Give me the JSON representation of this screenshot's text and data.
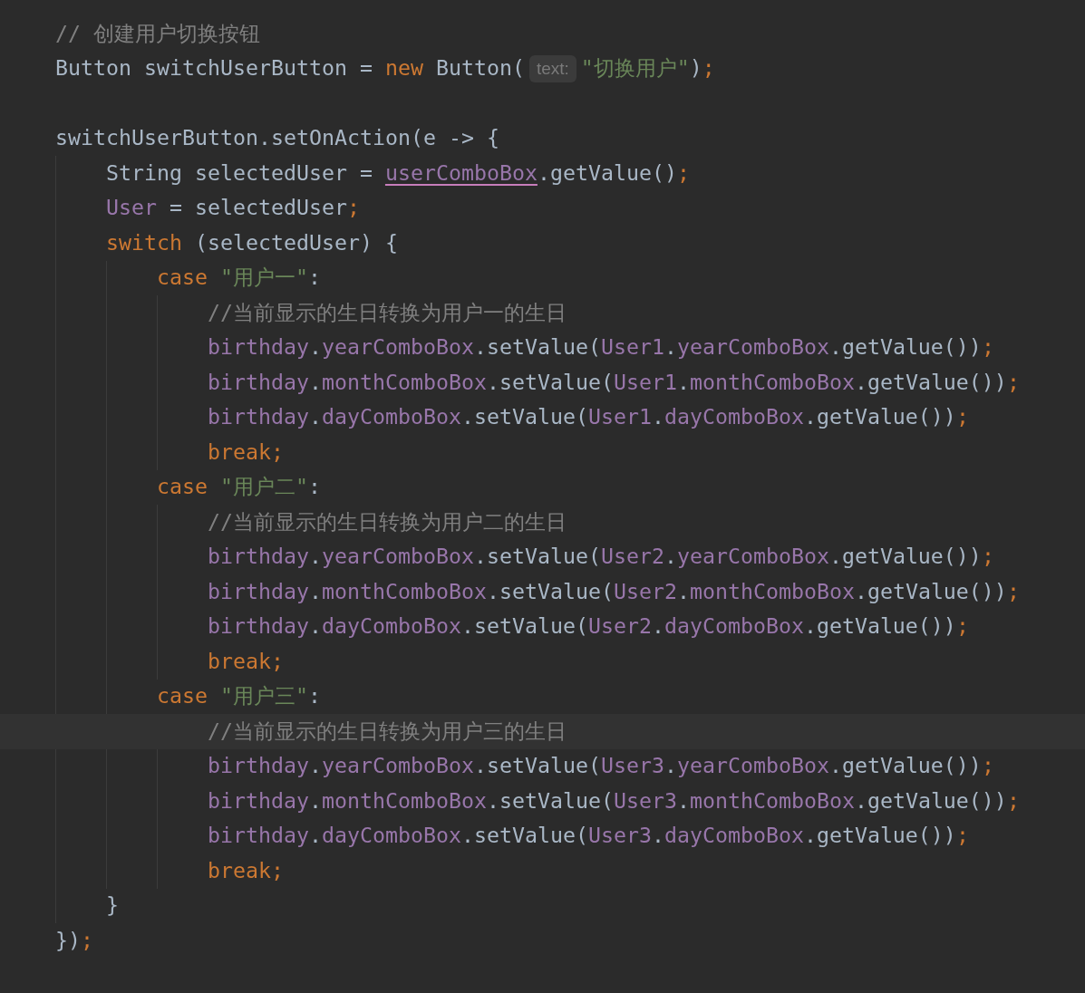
{
  "lines": [
    {
      "kind": "code",
      "tokens": [
        {
          "kind": "comment",
          "text": "// 创建用户切换按钮"
        }
      ]
    },
    {
      "kind": "code",
      "tokens": [
        {
          "kind": "plain",
          "text": "Button switchUserButton = "
        },
        {
          "kind": "keyword",
          "text": "new"
        },
        {
          "kind": "plain",
          "text": " Button("
        },
        {
          "kind": "hint",
          "text": "text:"
        },
        {
          "kind": "string",
          "text": "\"切换用户\""
        },
        {
          "kind": "plain",
          "text": ")"
        },
        {
          "kind": "keyword",
          "text": ";"
        }
      ]
    },
    {
      "kind": "blank"
    },
    {
      "kind": "code",
      "tokens": [
        {
          "kind": "plain",
          "text": "switchUserButton.setOnAction(e -> {"
        }
      ],
      "children": [
        {
          "kind": "code",
          "tokens": [
            {
              "kind": "plain",
              "text": "String selectedUser = "
            },
            {
              "kind": "underlined",
              "text": "userComboBox"
            },
            {
              "kind": "plain",
              "text": ".getValue()"
            },
            {
              "kind": "keyword",
              "text": ";"
            }
          ]
        },
        {
          "kind": "code",
          "tokens": [
            {
              "kind": "field",
              "text": "User"
            },
            {
              "kind": "plain",
              "text": " = selectedUser"
            },
            {
              "kind": "keyword",
              "text": ";"
            }
          ]
        },
        {
          "kind": "code",
          "tokens": [
            {
              "kind": "keyword",
              "text": "switch"
            },
            {
              "kind": "plain",
              "text": " (selectedUser) {"
            }
          ],
          "children": [
            {
              "kind": "code",
              "tokens": [
                {
                  "kind": "keyword",
                  "text": "case"
                },
                {
                  "kind": "string",
                  "text": " \"用户一\""
                },
                {
                  "kind": "plain",
                  "text": ":"
                }
              ],
              "children": [
                {
                  "kind": "code",
                  "tokens": [
                    {
                      "kind": "comment",
                      "text": "//当前显示的生日转换为用户一的生日"
                    }
                  ]
                },
                {
                  "kind": "code",
                  "tokens": [
                    {
                      "kind": "field",
                      "text": "birthday"
                    },
                    {
                      "kind": "plain",
                      "text": "."
                    },
                    {
                      "kind": "field",
                      "text": "yearComboBox"
                    },
                    {
                      "kind": "plain",
                      "text": ".setValue("
                    },
                    {
                      "kind": "field",
                      "text": "User1"
                    },
                    {
                      "kind": "plain",
                      "text": "."
                    },
                    {
                      "kind": "field",
                      "text": "yearComboBox"
                    },
                    {
                      "kind": "plain",
                      "text": ".getValue())"
                    },
                    {
                      "kind": "keyword",
                      "text": ";"
                    }
                  ]
                },
                {
                  "kind": "code",
                  "tokens": [
                    {
                      "kind": "field",
                      "text": "birthday"
                    },
                    {
                      "kind": "plain",
                      "text": "."
                    },
                    {
                      "kind": "field",
                      "text": "monthComboBox"
                    },
                    {
                      "kind": "plain",
                      "text": ".setValue("
                    },
                    {
                      "kind": "field",
                      "text": "User1"
                    },
                    {
                      "kind": "plain",
                      "text": "."
                    },
                    {
                      "kind": "field",
                      "text": "monthComboBox"
                    },
                    {
                      "kind": "plain",
                      "text": ".getValue())"
                    },
                    {
                      "kind": "keyword",
                      "text": ";"
                    }
                  ]
                },
                {
                  "kind": "code",
                  "tokens": [
                    {
                      "kind": "field",
                      "text": "birthday"
                    },
                    {
                      "kind": "plain",
                      "text": "."
                    },
                    {
                      "kind": "field",
                      "text": "dayComboBox"
                    },
                    {
                      "kind": "plain",
                      "text": ".setValue("
                    },
                    {
                      "kind": "field",
                      "text": "User1"
                    },
                    {
                      "kind": "plain",
                      "text": "."
                    },
                    {
                      "kind": "field",
                      "text": "dayComboBox"
                    },
                    {
                      "kind": "plain",
                      "text": ".getValue())"
                    },
                    {
                      "kind": "keyword",
                      "text": ";"
                    }
                  ]
                },
                {
                  "kind": "code",
                  "tokens": [
                    {
                      "kind": "keyword",
                      "text": "break;"
                    }
                  ]
                }
              ]
            },
            {
              "kind": "code",
              "tokens": [
                {
                  "kind": "keyword",
                  "text": "case"
                },
                {
                  "kind": "string",
                  "text": " \"用户二\""
                },
                {
                  "kind": "plain",
                  "text": ":"
                }
              ],
              "children": [
                {
                  "kind": "code",
                  "tokens": [
                    {
                      "kind": "comment",
                      "text": "//当前显示的生日转换为用户二的生日"
                    }
                  ]
                },
                {
                  "kind": "code",
                  "tokens": [
                    {
                      "kind": "field",
                      "text": "birthday"
                    },
                    {
                      "kind": "plain",
                      "text": "."
                    },
                    {
                      "kind": "field",
                      "text": "yearComboBox"
                    },
                    {
                      "kind": "plain",
                      "text": ".setValue("
                    },
                    {
                      "kind": "field",
                      "text": "User2"
                    },
                    {
                      "kind": "plain",
                      "text": "."
                    },
                    {
                      "kind": "field",
                      "text": "yearComboBox"
                    },
                    {
                      "kind": "plain",
                      "text": ".getValue())"
                    },
                    {
                      "kind": "keyword",
                      "text": ";"
                    }
                  ]
                },
                {
                  "kind": "code",
                  "tokens": [
                    {
                      "kind": "field",
                      "text": "birthday"
                    },
                    {
                      "kind": "plain",
                      "text": "."
                    },
                    {
                      "kind": "field",
                      "text": "monthComboBox"
                    },
                    {
                      "kind": "plain",
                      "text": ".setValue("
                    },
                    {
                      "kind": "field",
                      "text": "User2"
                    },
                    {
                      "kind": "plain",
                      "text": "."
                    },
                    {
                      "kind": "field",
                      "text": "monthComboBox"
                    },
                    {
                      "kind": "plain",
                      "text": ".getValue())"
                    },
                    {
                      "kind": "keyword",
                      "text": ";"
                    }
                  ]
                },
                {
                  "kind": "code",
                  "tokens": [
                    {
                      "kind": "field",
                      "text": "birthday"
                    },
                    {
                      "kind": "plain",
                      "text": "."
                    },
                    {
                      "kind": "field",
                      "text": "dayComboBox"
                    },
                    {
                      "kind": "plain",
                      "text": ".setValue("
                    },
                    {
                      "kind": "field",
                      "text": "User2"
                    },
                    {
                      "kind": "plain",
                      "text": "."
                    },
                    {
                      "kind": "field",
                      "text": "dayComboBox"
                    },
                    {
                      "kind": "plain",
                      "text": ".getValue())"
                    },
                    {
                      "kind": "keyword",
                      "text": ";"
                    }
                  ]
                },
                {
                  "kind": "code",
                  "tokens": [
                    {
                      "kind": "keyword",
                      "text": "break;"
                    }
                  ]
                }
              ]
            },
            {
              "kind": "code",
              "tokens": [
                {
                  "kind": "keyword",
                  "text": "case"
                },
                {
                  "kind": "string",
                  "text": " \"用户三\""
                },
                {
                  "kind": "plain",
                  "text": ":"
                }
              ],
              "children": [
                {
                  "kind": "code",
                  "current": true,
                  "tokens": [
                    {
                      "kind": "comment",
                      "text": "//当前显示的生日转换为用户三的生日"
                    }
                  ]
                },
                {
                  "kind": "code",
                  "tokens": [
                    {
                      "kind": "field",
                      "text": "birthday"
                    },
                    {
                      "kind": "plain",
                      "text": "."
                    },
                    {
                      "kind": "field",
                      "text": "yearComboBox"
                    },
                    {
                      "kind": "plain",
                      "text": ".setValue("
                    },
                    {
                      "kind": "field",
                      "text": "User3"
                    },
                    {
                      "kind": "plain",
                      "text": "."
                    },
                    {
                      "kind": "field",
                      "text": "yearComboBox"
                    },
                    {
                      "kind": "plain",
                      "text": ".getValue())"
                    },
                    {
                      "kind": "keyword",
                      "text": ";"
                    }
                  ]
                },
                {
                  "kind": "code",
                  "tokens": [
                    {
                      "kind": "field",
                      "text": "birthday"
                    },
                    {
                      "kind": "plain",
                      "text": "."
                    },
                    {
                      "kind": "field",
                      "text": "monthComboBox"
                    },
                    {
                      "kind": "plain",
                      "text": ".setValue("
                    },
                    {
                      "kind": "field",
                      "text": "User3"
                    },
                    {
                      "kind": "plain",
                      "text": "."
                    },
                    {
                      "kind": "field",
                      "text": "monthComboBox"
                    },
                    {
                      "kind": "plain",
                      "text": ".getValue())"
                    },
                    {
                      "kind": "keyword",
                      "text": ";"
                    }
                  ]
                },
                {
                  "kind": "code",
                  "tokens": [
                    {
                      "kind": "field",
                      "text": "birthday"
                    },
                    {
                      "kind": "plain",
                      "text": "."
                    },
                    {
                      "kind": "field",
                      "text": "dayComboBox"
                    },
                    {
                      "kind": "plain",
                      "text": ".setValue("
                    },
                    {
                      "kind": "field",
                      "text": "User3"
                    },
                    {
                      "kind": "plain",
                      "text": "."
                    },
                    {
                      "kind": "field",
                      "text": "dayComboBox"
                    },
                    {
                      "kind": "plain",
                      "text": ".getValue())"
                    },
                    {
                      "kind": "keyword",
                      "text": ";"
                    }
                  ]
                },
                {
                  "kind": "code",
                  "tokens": [
                    {
                      "kind": "keyword",
                      "text": "break;"
                    }
                  ]
                }
              ]
            }
          ]
        },
        {
          "kind": "code",
          "tokens": [
            {
              "kind": "plain",
              "text": "}"
            }
          ]
        }
      ]
    },
    {
      "kind": "code",
      "tokens": [
        {
          "kind": "plain",
          "text": "})"
        },
        {
          "kind": "keyword",
          "text": ";"
        }
      ]
    }
  ]
}
